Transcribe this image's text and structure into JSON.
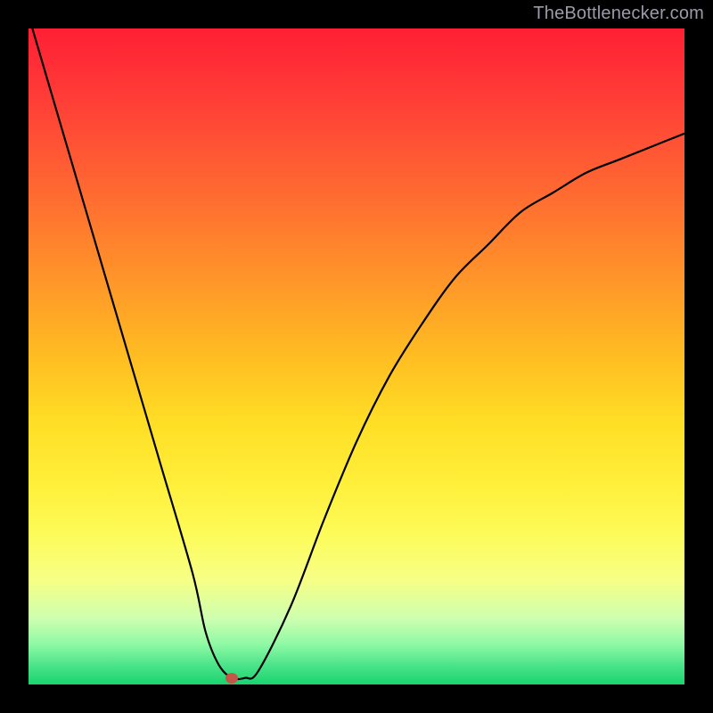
{
  "watermark": "TheBottlenecker.com",
  "colors": {
    "frame": "#000000",
    "line": "#000000",
    "marker": "#c45648",
    "watermark": "#9b9baa"
  },
  "chart_data": {
    "type": "line",
    "title": "",
    "xlabel": "",
    "ylabel": "",
    "xlim": [
      0,
      100
    ],
    "ylim": [
      0,
      100
    ],
    "grid": false,
    "legend": false,
    "x": [
      0,
      5,
      10,
      15,
      20,
      25,
      27,
      29,
      31,
      33,
      35,
      40,
      45,
      50,
      55,
      60,
      65,
      70,
      75,
      80,
      85,
      90,
      95,
      100
    ],
    "values": [
      102,
      85,
      68,
      51,
      34,
      17,
      8,
      3,
      1,
      1,
      2,
      12,
      25,
      37,
      47,
      55,
      62,
      67,
      72,
      75,
      78,
      80,
      82,
      84
    ],
    "marker": {
      "x": 31,
      "y": 1
    }
  }
}
